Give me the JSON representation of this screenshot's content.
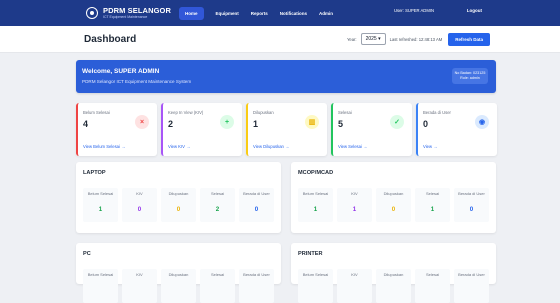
{
  "nav": {
    "brand_title": "PDRM SELANGOR",
    "brand_subtitle": "ICT Equipment Maintenance",
    "items": [
      "Home",
      "Equipment",
      "Reports",
      "Notifications",
      "Admin"
    ],
    "user": "User: SUPER ADMIN",
    "logout": "Logout"
  },
  "header": {
    "title": "Dashboard",
    "year_label": "Year:",
    "year_value": "2025",
    "refreshed": "Last refreshed: 12:48:13 AM",
    "refresh_button": "Refresh Data"
  },
  "welcome": {
    "title": "Welcome, SUPER ADMIN",
    "subtitle": "PDRM Selangor ICT Equipment Maintenance System",
    "badge_line1": "No Badan: 023125",
    "badge_line2": "Role: admin"
  },
  "stats": [
    {
      "label": "Belum Selesai",
      "value": "4",
      "link": "View Belum Selesai →",
      "icon": "x-icon",
      "color": "#ef4444"
    },
    {
      "label": "Keep In View (KIV)",
      "value": "2",
      "link": "View KIV →",
      "icon": "plus-icon",
      "color": "#a855f7"
    },
    {
      "label": "Dilupuskan",
      "value": "1",
      "link": "View Dilupuskan →",
      "icon": "trash-icon",
      "color": "#facc15"
    },
    {
      "label": "Selesai",
      "value": "5",
      "link": "View Selesai →",
      "icon": "check-icon",
      "color": "#22c55e"
    },
    {
      "label": "Berada di User",
      "value": "0",
      "link": "View →",
      "icon": "user-icon",
      "color": "#3b82f6"
    }
  ],
  "panels": [
    {
      "title": "LAPTOP",
      "metrics": [
        {
          "label": "Belum Selesai",
          "value": "1",
          "color": "#16a34a"
        },
        {
          "label": "KIV",
          "value": "0",
          "color": "#9333ea"
        },
        {
          "label": "Dilupuskan",
          "value": "0",
          "color": "#eab308"
        },
        {
          "label": "Selesai",
          "value": "2",
          "color": "#16a34a"
        },
        {
          "label": "Berada di User",
          "value": "0",
          "color": "#2563eb"
        }
      ]
    },
    {
      "title": "MCOP/MCAD",
      "metrics": [
        {
          "label": "Belum Selesai",
          "value": "1",
          "color": "#16a34a"
        },
        {
          "label": "KIV",
          "value": "1",
          "color": "#9333ea"
        },
        {
          "label": "Dilupuskan",
          "value": "0",
          "color": "#eab308"
        },
        {
          "label": "Selesai",
          "value": "1",
          "color": "#16a34a"
        },
        {
          "label": "Berada di User",
          "value": "0",
          "color": "#2563eb"
        }
      ]
    },
    {
      "title": "PC",
      "metrics": [
        {
          "label": "Belum Selesai",
          "value": "",
          "color": "#16a34a"
        },
        {
          "label": "KIV",
          "value": "",
          "color": "#9333ea"
        },
        {
          "label": "Dilupuskan",
          "value": "",
          "color": "#eab308"
        },
        {
          "label": "Selesai",
          "value": "",
          "color": "#16a34a"
        },
        {
          "label": "Berada di User",
          "value": "",
          "color": "#2563eb"
        }
      ]
    },
    {
      "title": "PRINTER",
      "metrics": [
        {
          "label": "Belum Selesai",
          "value": "",
          "color": "#16a34a"
        },
        {
          "label": "KIV",
          "value": "",
          "color": "#9333ea"
        },
        {
          "label": "Dilupuskan",
          "value": "",
          "color": "#eab308"
        },
        {
          "label": "Selesai",
          "value": "",
          "color": "#16a34a"
        },
        {
          "label": "Berada di User",
          "value": "",
          "color": "#2563eb"
        }
      ]
    }
  ]
}
